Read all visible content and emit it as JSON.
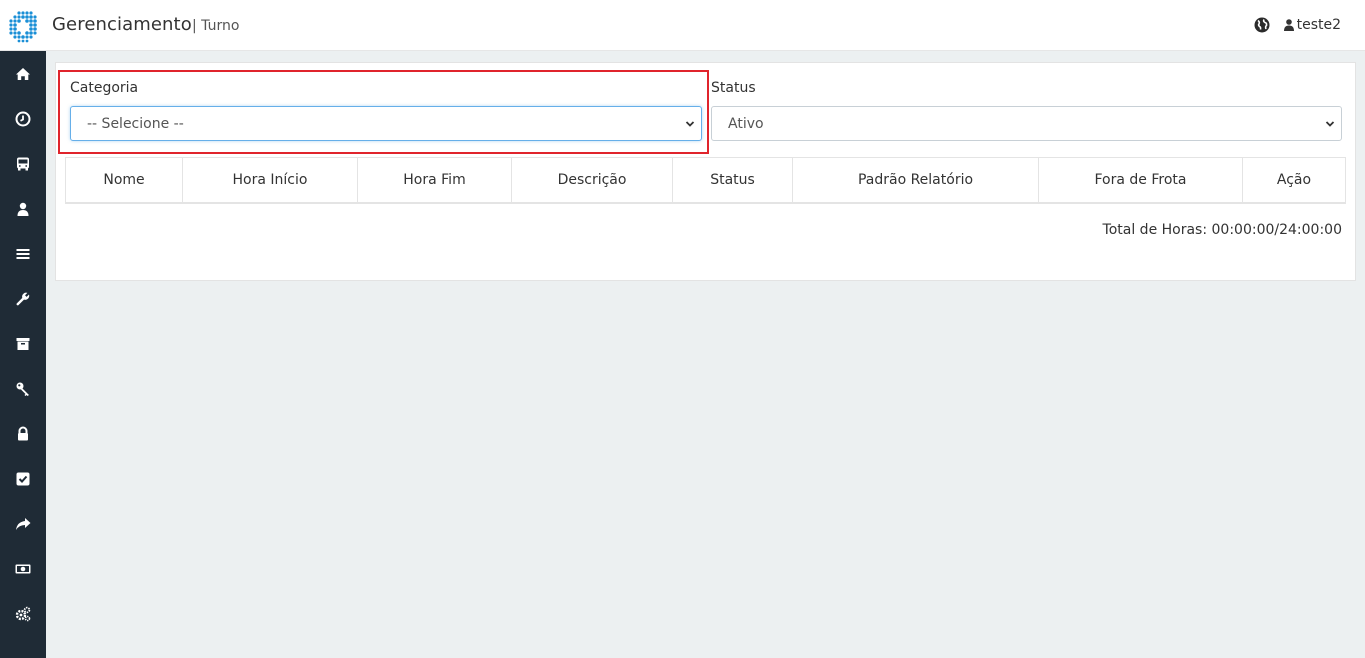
{
  "header": {
    "app_title": "Gerenciamento",
    "separator": "|",
    "subtitle": "Turno",
    "language_icon": "globe-icon",
    "user_icon": "user-icon",
    "username": "teste2"
  },
  "sidebar": {
    "items": [
      {
        "icon": "home-icon"
      },
      {
        "icon": "clock-icon"
      },
      {
        "icon": "bus-icon"
      },
      {
        "icon": "user-icon"
      },
      {
        "icon": "menu-icon"
      },
      {
        "icon": "wrench-icon"
      },
      {
        "icon": "archive-icon"
      },
      {
        "icon": "key-icon"
      },
      {
        "icon": "lock-icon"
      },
      {
        "icon": "check-square-icon"
      },
      {
        "icon": "share-icon"
      },
      {
        "icon": "money-icon"
      },
      {
        "icon": "cogs-icon"
      }
    ]
  },
  "filters": {
    "categoria_label": "Categoria",
    "categoria_value": "-- Selecione --",
    "status_label": "Status",
    "status_value": "Ativo"
  },
  "table": {
    "columns": [
      "Nome",
      "Hora Início",
      "Hora Fim",
      "Descrição",
      "Status",
      "Padrão Relatório",
      "Fora de Frota",
      "Ação"
    ]
  },
  "total": {
    "text": "Total de Horas: 00:00:00/24:00:00"
  },
  "colors": {
    "sidebar_bg": "#1f2b36",
    "page_bg": "#ecf0f1",
    "highlight": "#e0242c",
    "logo_blue": "#1a8fd6"
  }
}
